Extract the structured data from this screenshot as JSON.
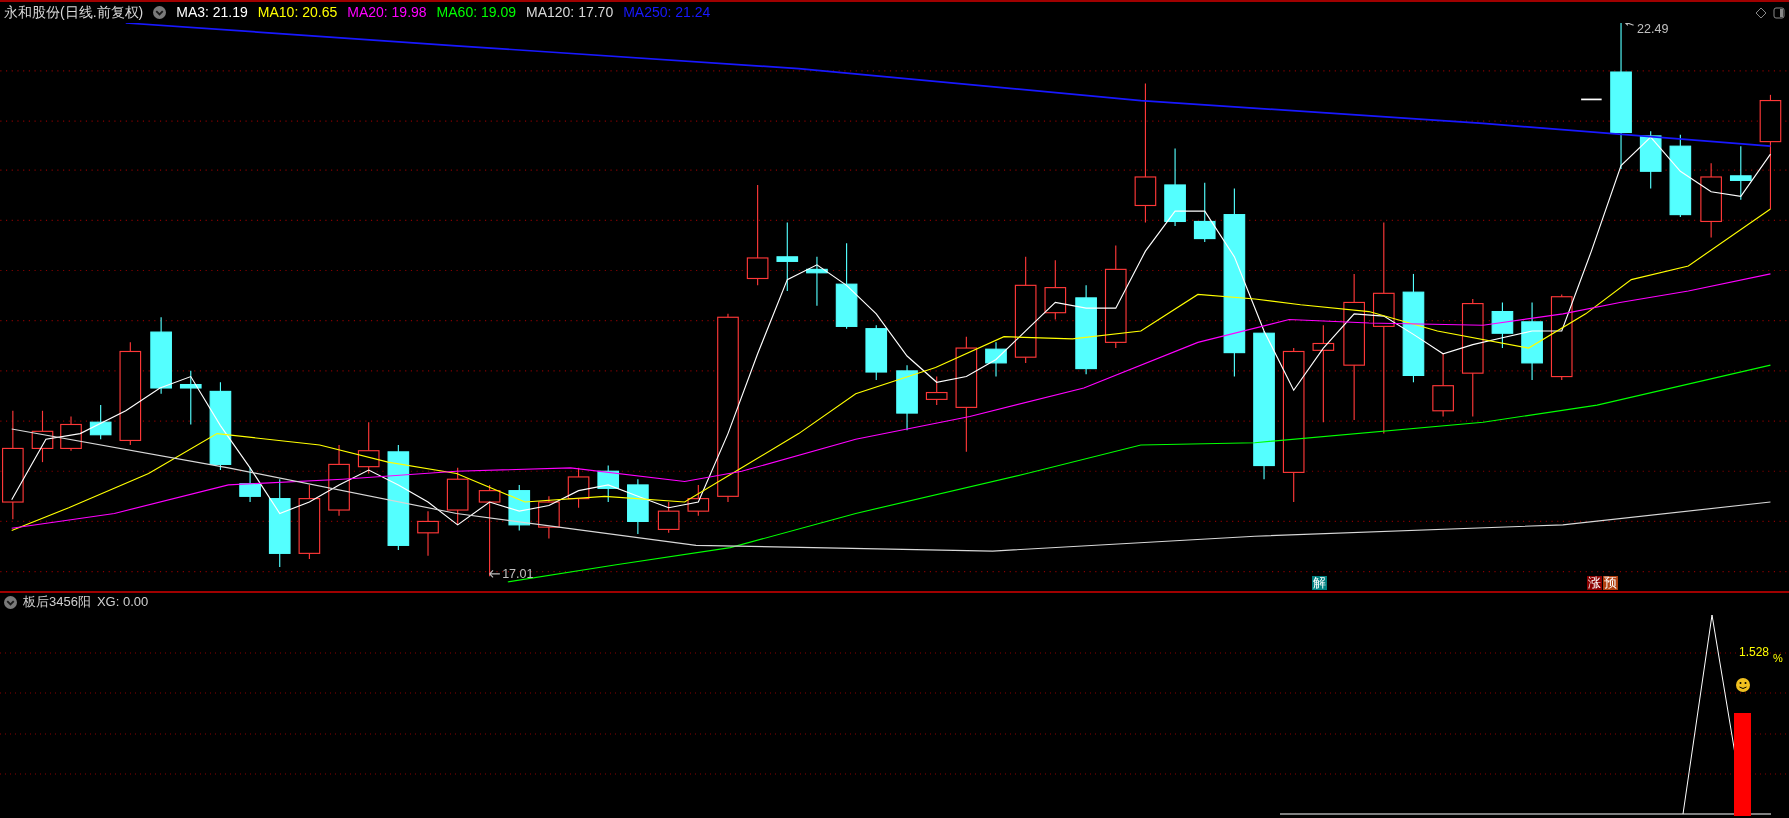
{
  "title": "永和股份(日线.前复权)",
  "ma_legend": [
    {
      "label": "MA3: 21.19",
      "color": "#ffffff"
    },
    {
      "label": "MA10: 20.65",
      "color": "#ffff00"
    },
    {
      "label": "MA20: 19.98",
      "color": "#ff00ff"
    },
    {
      "label": "MA60: 19.09",
      "color": "#00ff00"
    },
    {
      "label": "MA120: 17.70",
      "color": "#d8d8d8"
    },
    {
      "label": "MA250: 21.24",
      "color": "#1818ff"
    }
  ],
  "main_chart": {
    "high_label": "22.49",
    "low_label": "17.01",
    "signals": [
      {
        "text": "解",
        "color": "#008080"
      },
      {
        "text": "涨",
        "color": "#8b0000"
      },
      {
        "text": "预",
        "color": "#b04010"
      }
    ]
  },
  "indicator": {
    "title": "板后3456阳",
    "reading": "XG: 0.00",
    "value": "1.528",
    "unit": "%"
  }
}
